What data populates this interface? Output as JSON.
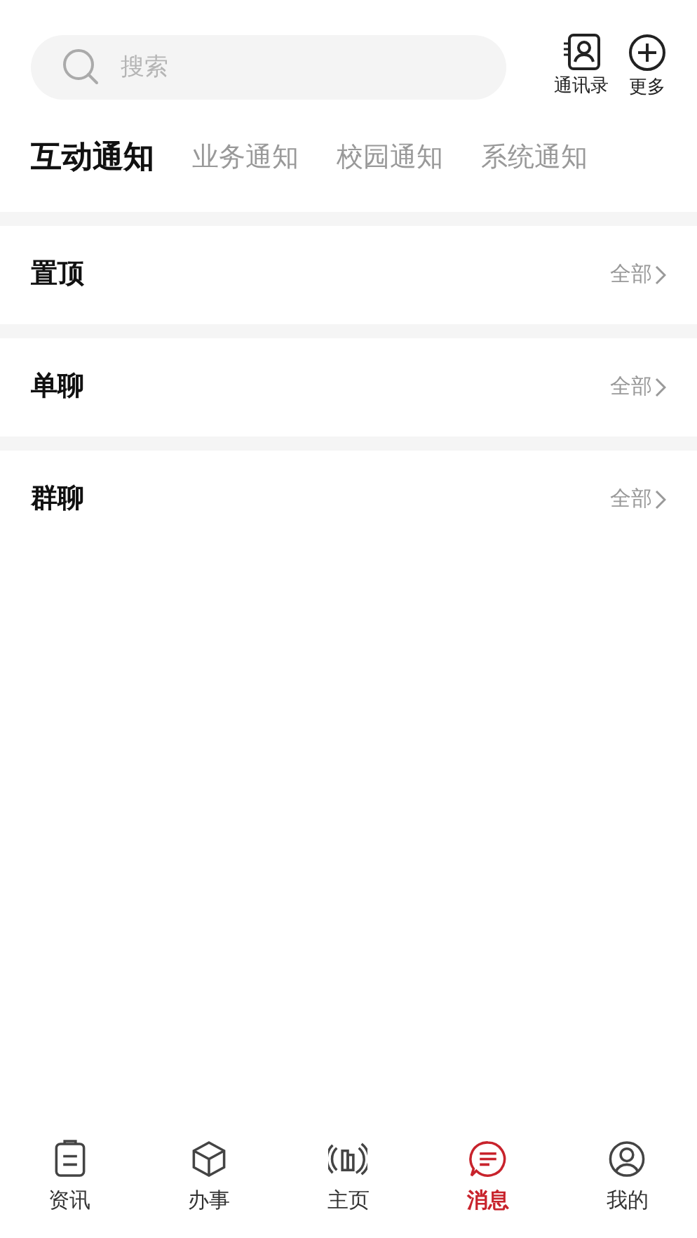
{
  "search": {
    "placeholder": "搜索"
  },
  "header_actions": [
    {
      "label": "通讯录"
    },
    {
      "label": "更多"
    }
  ],
  "tabs": [
    {
      "label": "互动通知",
      "selected": true
    },
    {
      "label": "业务通知",
      "selected": false
    },
    {
      "label": "校园通知",
      "selected": false
    },
    {
      "label": "系统通知",
      "selected": false
    }
  ],
  "sections": [
    {
      "title": "置顶",
      "link": "全部"
    },
    {
      "title": "单聊",
      "link": "全部"
    },
    {
      "title": "群聊",
      "link": "全部"
    }
  ],
  "nav": [
    {
      "label": "资讯",
      "selected": false
    },
    {
      "label": "办事",
      "selected": false
    },
    {
      "label": "主页",
      "selected": false
    },
    {
      "label": "消息",
      "selected": true
    },
    {
      "label": "我的",
      "selected": false
    }
  ]
}
